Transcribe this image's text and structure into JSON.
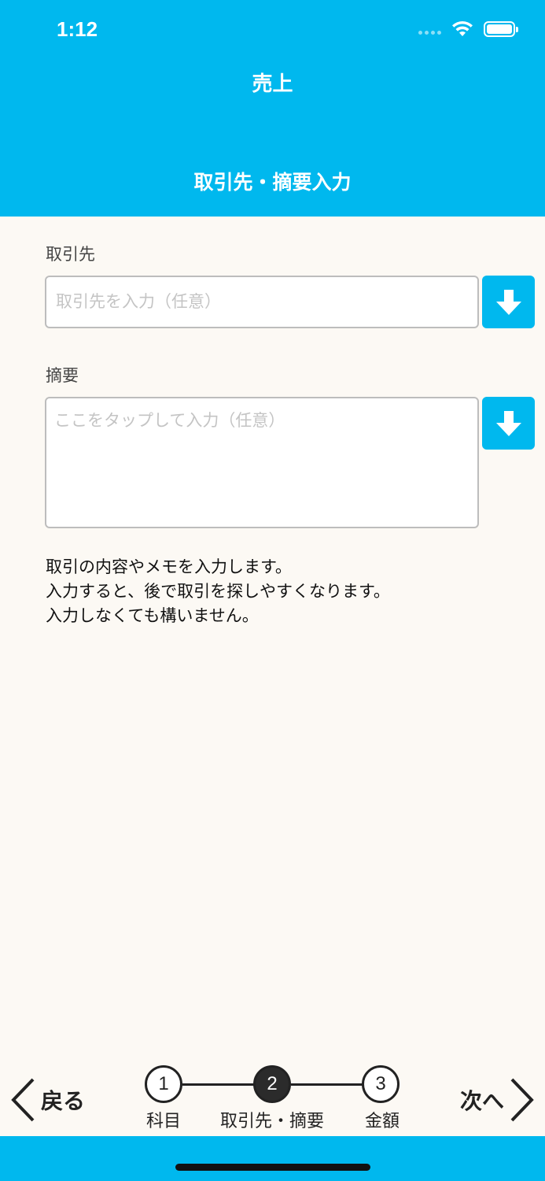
{
  "status": {
    "time": "1:12"
  },
  "nav": {
    "title": "売上",
    "subtitle": "取引先・摘要入力"
  },
  "partner": {
    "label": "取引先",
    "placeholder": "取引先を入力（任意）"
  },
  "memo": {
    "label": "摘要",
    "placeholder": "ここをタップして入力（任意）"
  },
  "help": [
    "取引の内容やメモを入力します。",
    "入力すると、後で取引を探しやすくなります。",
    "入力しなくても構いません。"
  ],
  "footer": {
    "back_label": "戻る",
    "next_label": "次へ",
    "steps": [
      {
        "number": "1",
        "label": "科目",
        "active": false
      },
      {
        "number": "2",
        "label": "取引先・摘要",
        "active": true
      },
      {
        "number": "3",
        "label": "金額",
        "active": false
      }
    ]
  },
  "colors": {
    "accent": "#00b8ee",
    "background": "#fcf9f4",
    "step_active": "#2b2b2b"
  },
  "icons": {
    "download": "arrow-down-icon",
    "back": "chevron-left-icon",
    "next": "chevron-right-icon",
    "wifi": "wifi-icon",
    "battery": "battery-icon"
  }
}
